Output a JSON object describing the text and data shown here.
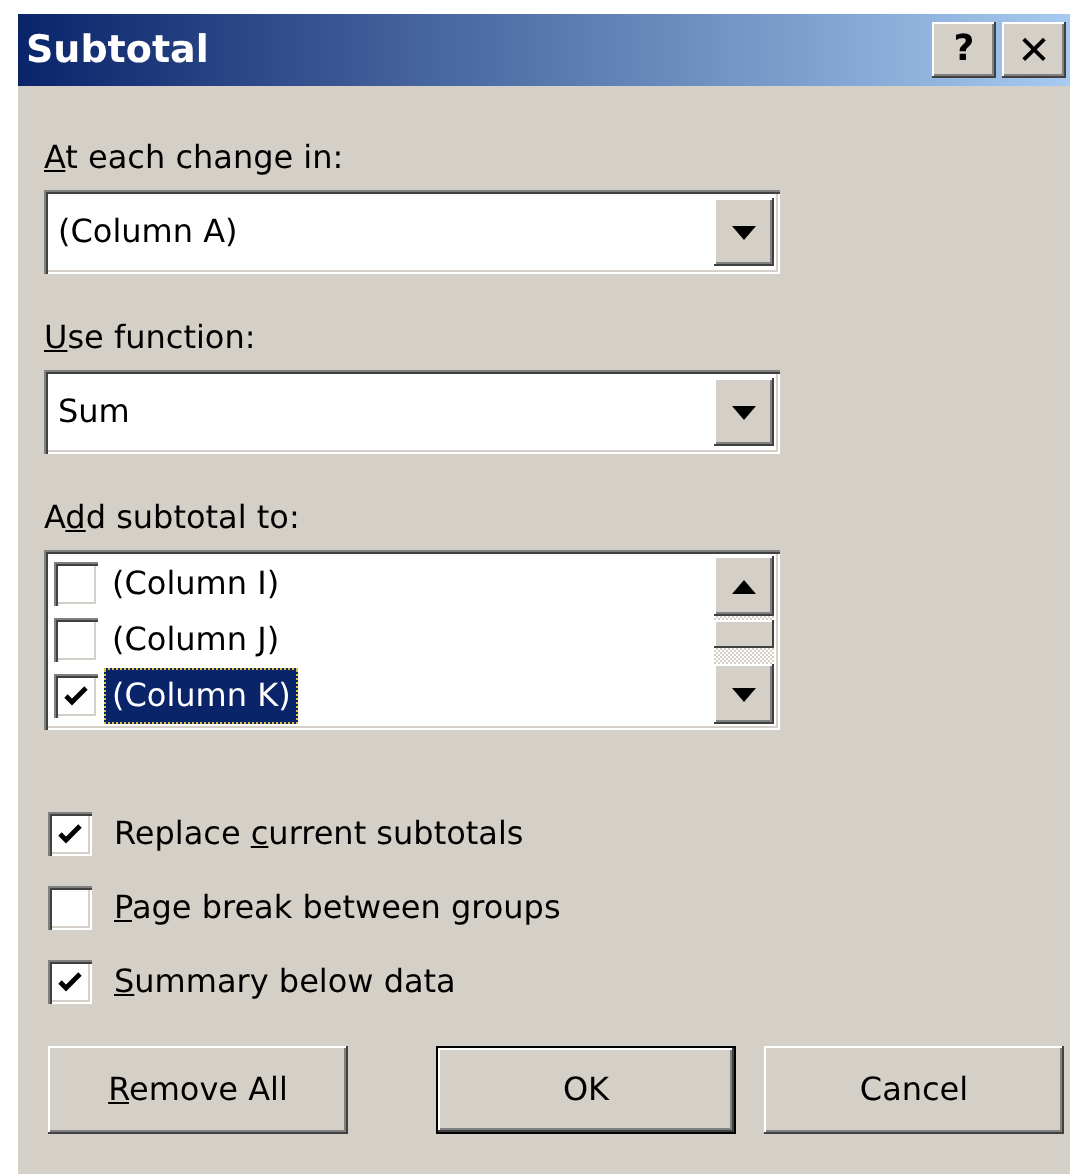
{
  "window": {
    "title": "Subtotal",
    "controls": [
      {
        "kind": "help",
        "label": "?"
      },
      {
        "kind": "close",
        "label": "✕"
      }
    ]
  },
  "change_field": {
    "label": {
      "key": "A",
      "after": "t each change in:"
    },
    "value": "(Column A)"
  },
  "function_field": {
    "label": {
      "key": "U",
      "after": "se function:"
    },
    "value": "Sum"
  },
  "subtotal_list": {
    "label": {
      "before": "A",
      "key": "d",
      "after": "d subtotal to:"
    },
    "items": [
      {
        "label": "(Column I)",
        "checked": false,
        "selected": false
      },
      {
        "label": "(Column J)",
        "checked": false,
        "selected": false
      },
      {
        "label": "(Column K)",
        "checked": true,
        "selected": true
      }
    ]
  },
  "options": [
    {
      "label": {
        "before": "Replace ",
        "key": "c",
        "after": "urrent subtotals"
      },
      "checked": true
    },
    {
      "label": {
        "key": "P",
        "after": "age break between groups"
      },
      "checked": false
    },
    {
      "label": {
        "key": "S",
        "after": "ummary below data"
      },
      "checked": true
    }
  ],
  "buttons": [
    {
      "label": {
        "key": "R",
        "after": "emove All"
      },
      "default": false
    },
    {
      "label": {
        "after": "OK"
      },
      "default": true
    },
    {
      "label": {
        "after": "Cancel"
      },
      "default": false
    }
  ]
}
